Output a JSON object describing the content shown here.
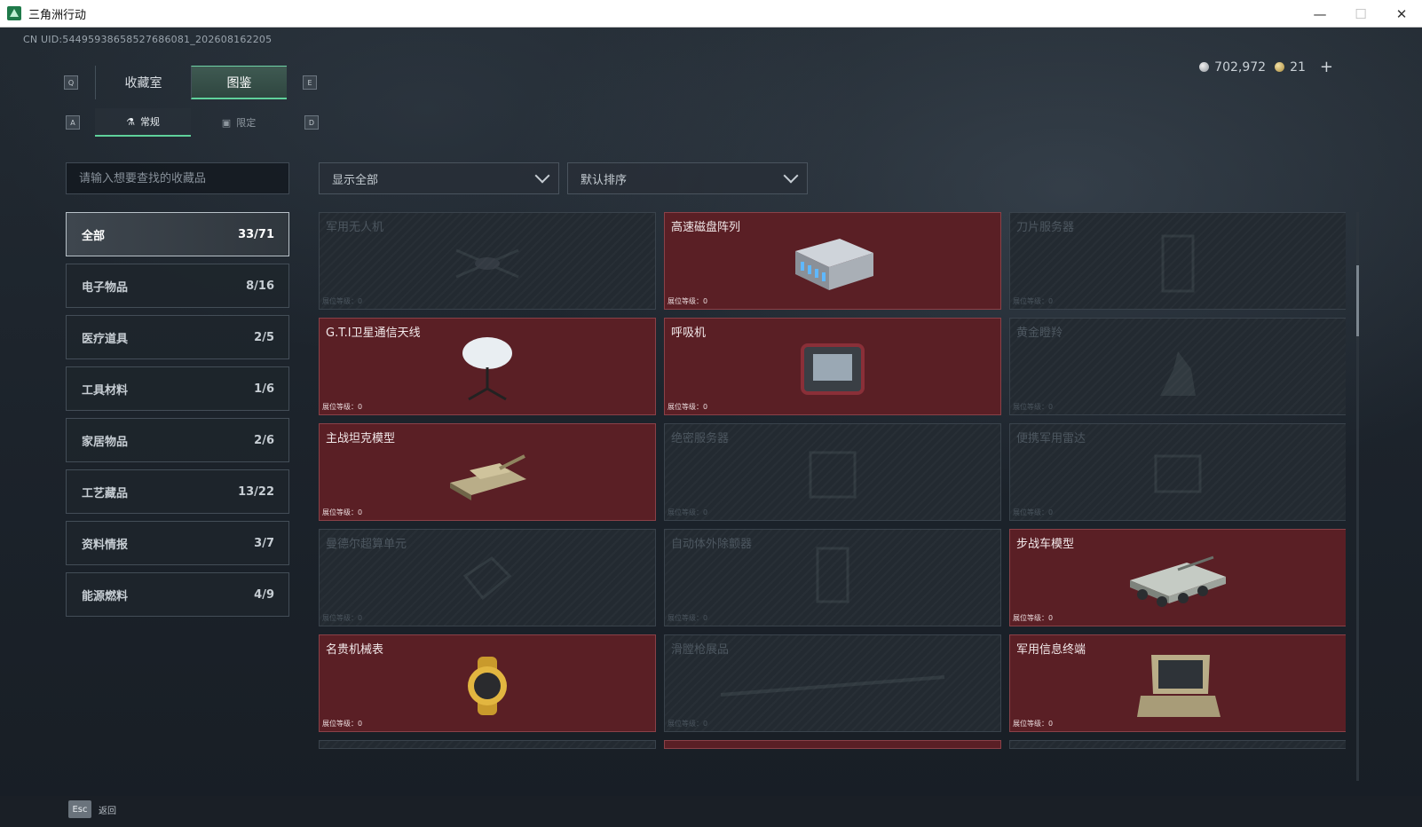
{
  "window": {
    "title": "三角洲行动",
    "minimize": "—",
    "maximize": "☐",
    "close": "✕"
  },
  "uid": "CN UID:5449593865852768608​1_202608162205",
  "currency": {
    "coins": "702,972",
    "gold": "21",
    "plus": "+"
  },
  "keys": {
    "q": "Q",
    "e": "E",
    "a": "A",
    "d": "D"
  },
  "tabs": {
    "collection_room": "收藏室",
    "catalog": "图鉴"
  },
  "subtabs": {
    "regular": "常规",
    "limited": "限定"
  },
  "search": {
    "placeholder": "请输入想要查找的收藏品"
  },
  "filters": {
    "show": "显示全部",
    "sort": "默认排序"
  },
  "categories": [
    {
      "label": "全部",
      "count": "33/71"
    },
    {
      "label": "电子物品",
      "count": "8/16"
    },
    {
      "label": "医疗道具",
      "count": "2/5"
    },
    {
      "label": "工具材料",
      "count": "1/6"
    },
    {
      "label": "家居物品",
      "count": "2/6"
    },
    {
      "label": "工艺藏品",
      "count": "13/22"
    },
    {
      "label": "资料情报",
      "count": "3/7"
    },
    {
      "label": "能源燃料",
      "count": "4/9"
    }
  ],
  "level_label": "展位等级：0",
  "items": [
    {
      "name": "军用无人机",
      "owned": false,
      "icon": "drone-icon"
    },
    {
      "name": "高速磁盘阵列",
      "owned": true,
      "icon": "disk-array-icon"
    },
    {
      "name": "刀片服务器",
      "owned": false,
      "icon": "blade-server-icon"
    },
    {
      "name": "G.T.I卫星通信天线",
      "owned": true,
      "icon": "satellite-dish-icon"
    },
    {
      "name": "呼吸机",
      "owned": true,
      "icon": "ventilator-icon"
    },
    {
      "name": "黄金瞪羚",
      "owned": false,
      "icon": "gazelle-statue-icon"
    },
    {
      "name": "主战坦克模型",
      "owned": true,
      "icon": "tank-model-icon"
    },
    {
      "name": "绝密服务器",
      "owned": false,
      "icon": "server-icon"
    },
    {
      "name": "便携军用雷达",
      "owned": false,
      "icon": "radar-icon"
    },
    {
      "name": "曼德尔超算单元",
      "owned": false,
      "icon": "supercomputer-icon"
    },
    {
      "name": "自动体外除颤器",
      "owned": false,
      "icon": "defibrillator-icon"
    },
    {
      "name": "步战车模型",
      "owned": true,
      "icon": "ifv-model-icon"
    },
    {
      "name": "名贵机械表",
      "owned": true,
      "icon": "watch-icon"
    },
    {
      "name": "滑膛枪展品",
      "owned": false,
      "icon": "musket-icon"
    },
    {
      "name": "军用信息终端",
      "owned": true,
      "icon": "terminal-icon"
    }
  ],
  "bottom": {
    "esc_key": "Esc",
    "back": "返回"
  }
}
